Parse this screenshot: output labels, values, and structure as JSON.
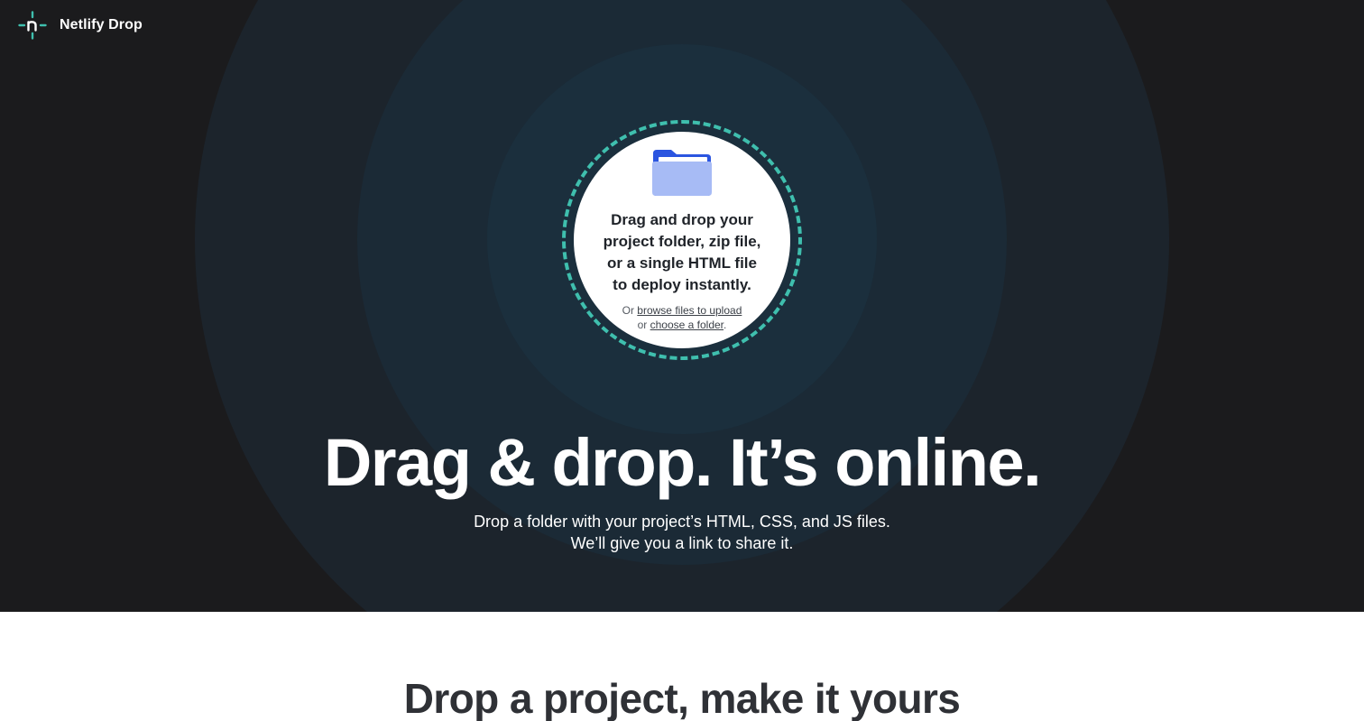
{
  "header": {
    "brand": "Netlify Drop",
    "logo_icon": "netlify-logo-icon"
  },
  "dropzone": {
    "icon": "folder-icon",
    "line1": "Drag and drop your",
    "line2": "project folder, zip file,",
    "line3": "or a single HTML file",
    "line4": "to deploy instantly.",
    "or_prefix": "Or ",
    "browse_link": "browse files to upload",
    "or_middle": "or ",
    "folder_link": "choose a folder",
    "period": "."
  },
  "hero": {
    "headline": "Drag & drop. It’s online.",
    "sub_line1": "Drop a folder with your project’s HTML, CSS, and JS files.",
    "sub_line2": "We’ll give you a link to share it."
  },
  "section": {
    "title": "Drop a project, make it yours"
  },
  "colors": {
    "hero_bg": "#1b1b1d",
    "ring_outer": "#1c242c",
    "ring_mid": "#1b2a36",
    "ring_inner": "#1b2f3d",
    "dash": "#3fbfae",
    "folder_back": "#2b55e0",
    "folder_front": "#a7bbf5"
  }
}
